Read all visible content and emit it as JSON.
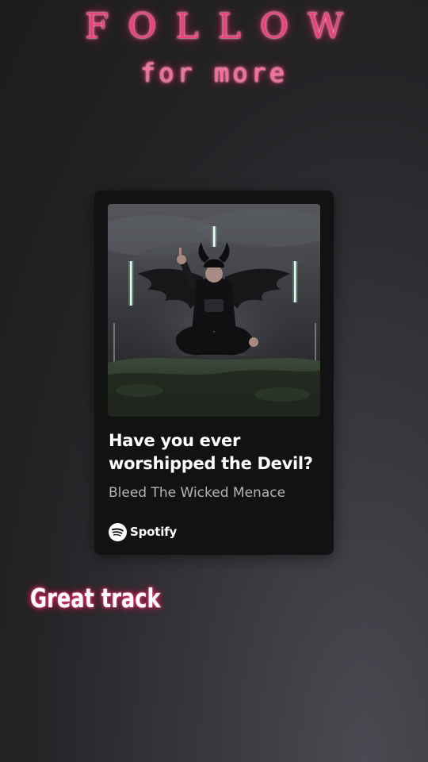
{
  "overlay": {
    "follow_title": "FOLLOW",
    "follow_subtitle": "for more",
    "caption": "Great track",
    "neon_color": "#e8447a"
  },
  "card": {
    "track_title": "Have you ever worshipped the Devil?",
    "artist": "Bleed The Wicked Menace",
    "brand_name": "Spotify",
    "brand_icon": "spotify-logo-icon",
    "background_color": "#121212",
    "title_color": "#ffffff",
    "artist_color": "#b3b3b3"
  }
}
